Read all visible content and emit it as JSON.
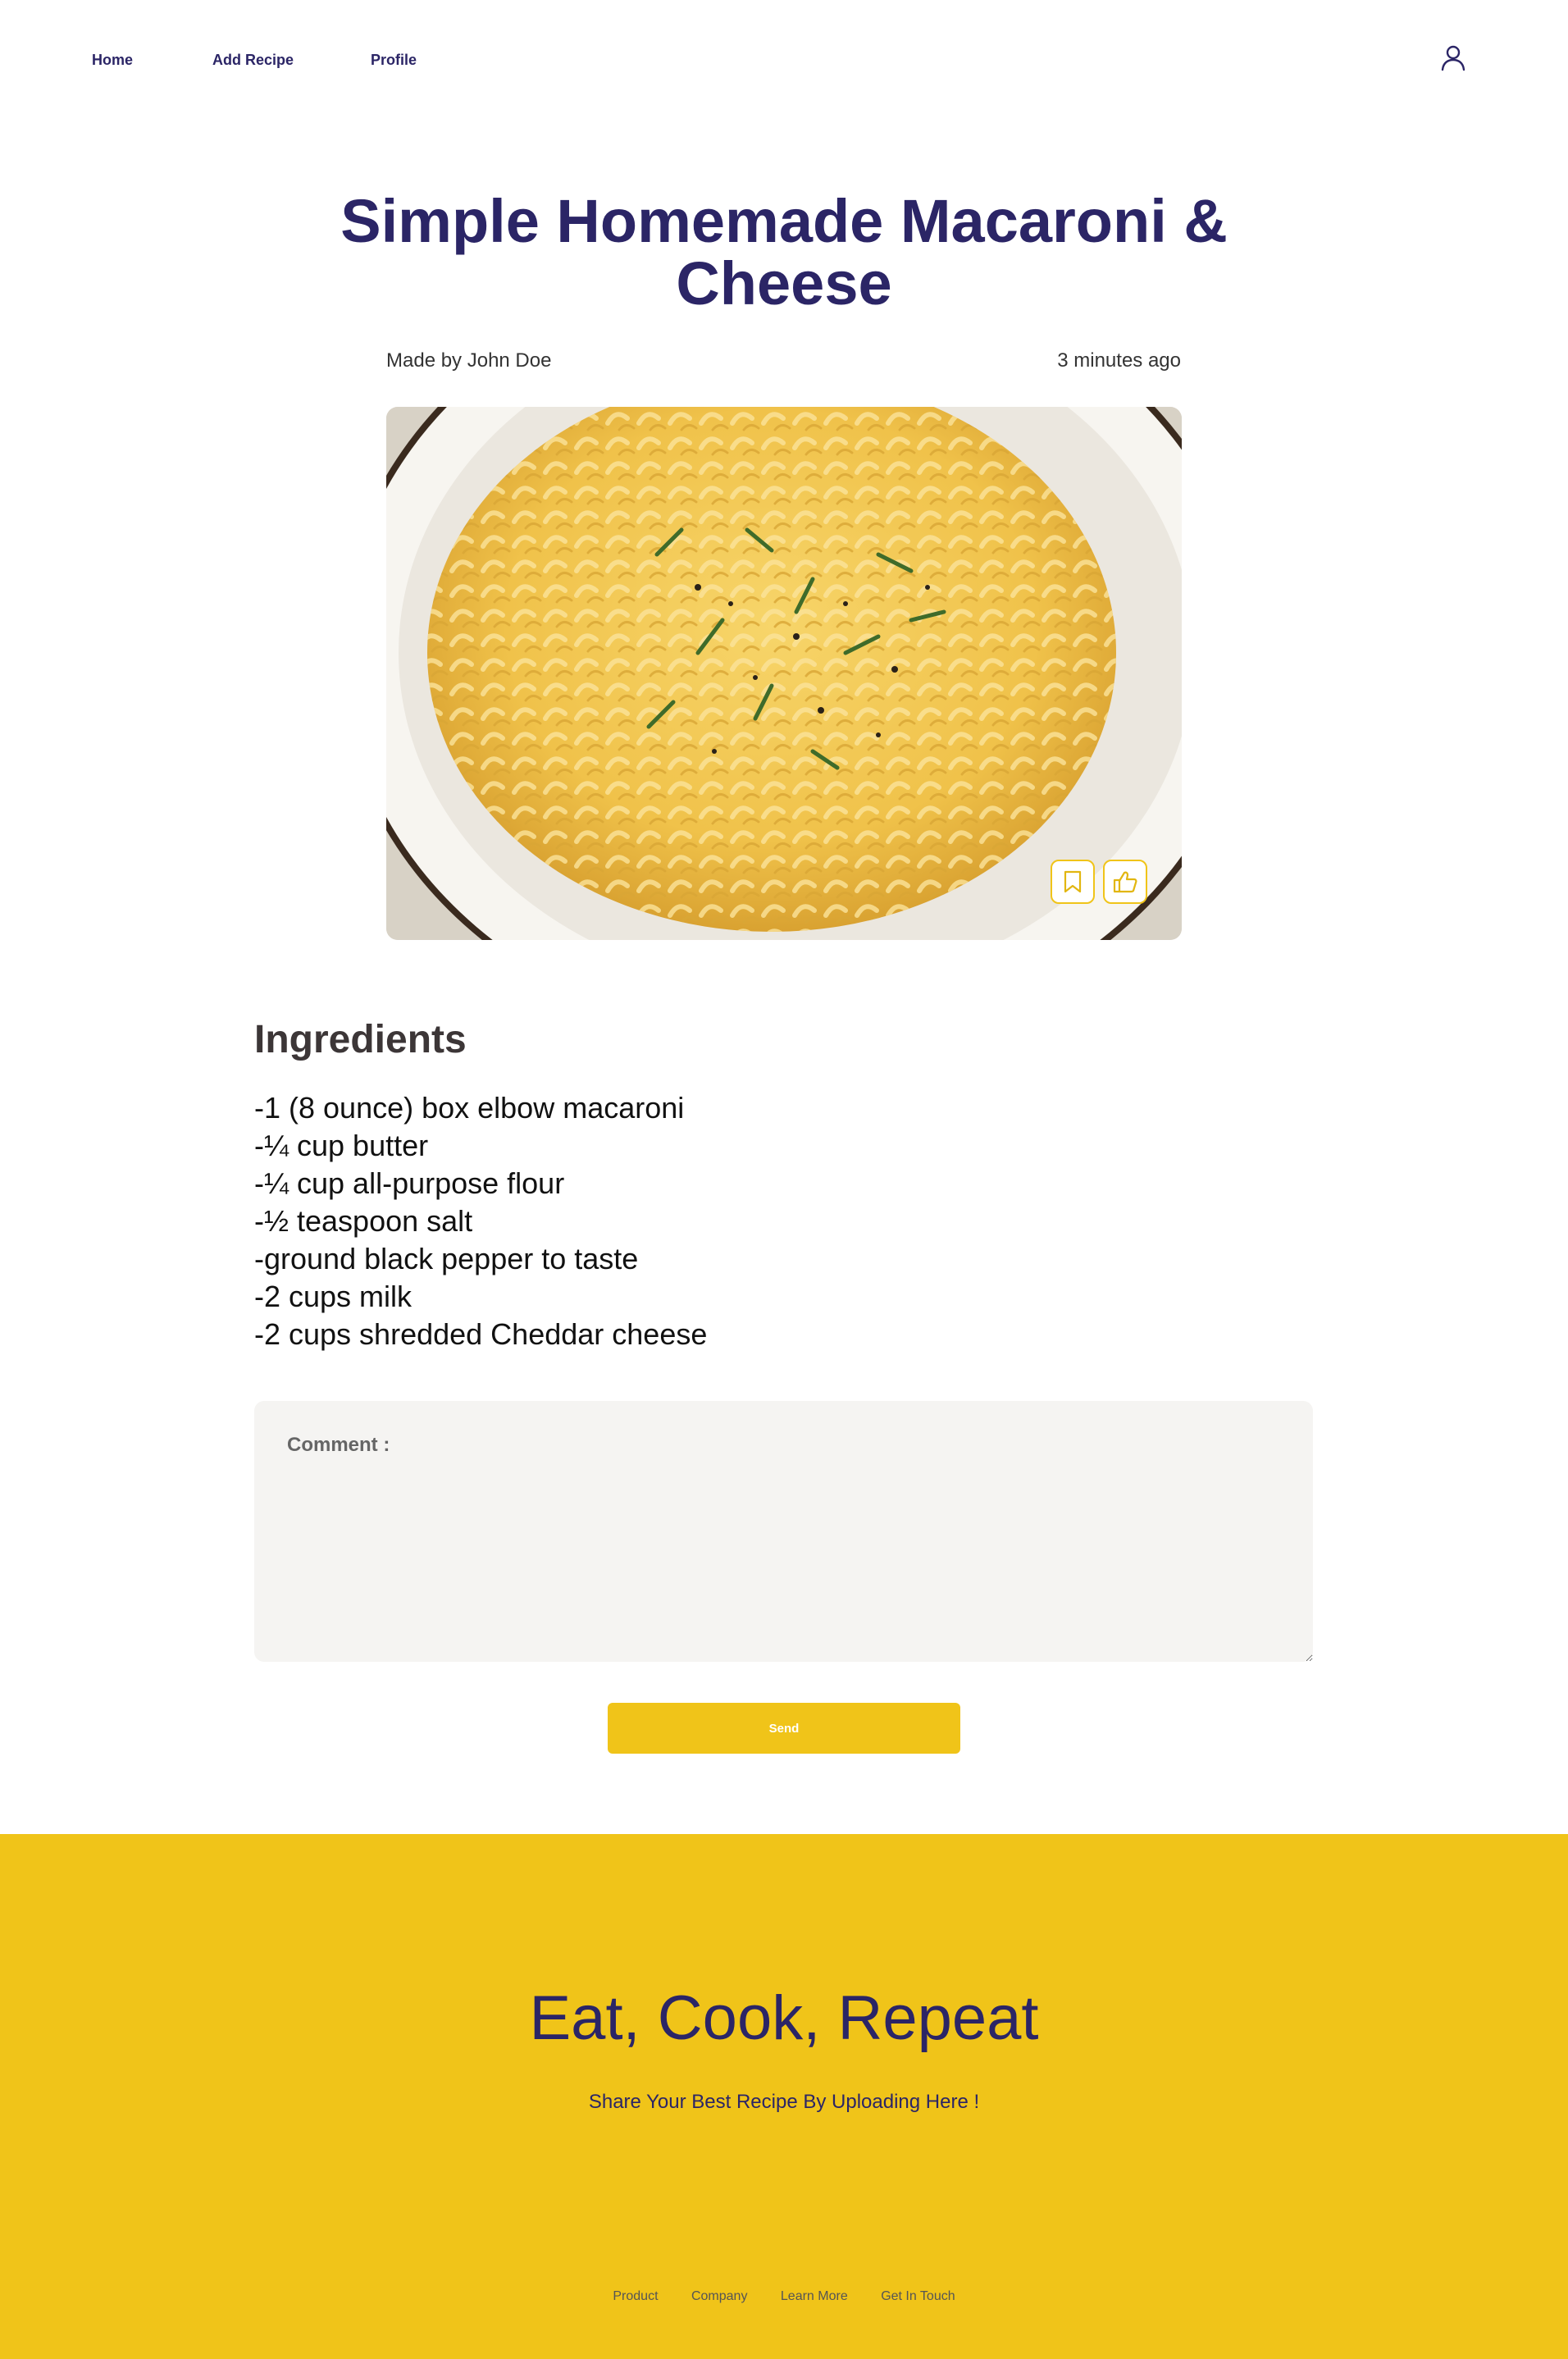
{
  "nav": {
    "items": [
      {
        "label": "Home"
      },
      {
        "label": "Add Recipe"
      },
      {
        "label": "Profile"
      }
    ],
    "user_icon": "user-icon"
  },
  "recipe": {
    "title": "Simple Homemade Macaroni & Cheese",
    "author": "Made by John Doe",
    "time": "3 minutes ago",
    "image_icons": [
      "bookmark-icon",
      "thumbs-up-icon"
    ]
  },
  "ingredients": {
    "heading": "Ingredients",
    "items": [
      "-1 (8 ounce) box elbow macaroni",
      "-¼ cup butter",
      "-¼ cup all-purpose flour",
      "-½ teaspoon salt",
      "-ground black pepper to taste",
      "-2 cups milk",
      "-2 cups shredded Cheddar cheese"
    ]
  },
  "comment": {
    "placeholder": "Comment :",
    "value": ""
  },
  "send_label": "Send",
  "footer": {
    "headline": "Eat, Cook, Repeat",
    "subline": "Share Your Best Recipe By Uploading Here !",
    "links": [
      "Product",
      "Company",
      "Learn More",
      "Get In Touch"
    ]
  },
  "colors": {
    "brand_navy": "#2b2566",
    "accent_yellow": "#f0c419"
  }
}
